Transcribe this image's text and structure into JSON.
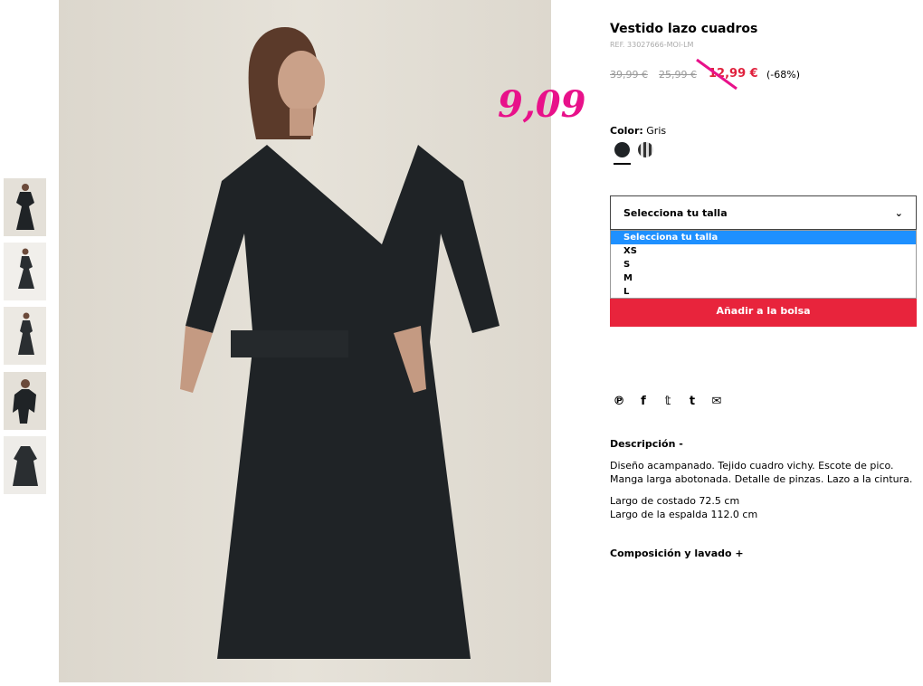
{
  "product": {
    "title": "Vestido lazo cuadros",
    "ref": "REF. 33027666-MOI-LM",
    "prices": {
      "old1": "39,99 €",
      "old2": "25,99 €",
      "current": "12,99 €",
      "discount": "(-68%)"
    },
    "handwritten_price": "9,09",
    "color_label": "Color:",
    "color_value": "Gris",
    "swatches": [
      "dark-solid",
      "gray-check"
    ]
  },
  "size": {
    "selected": "Selecciona tu talla",
    "options": [
      "Selecciona tu talla",
      "XS",
      "S",
      "M",
      "L"
    ]
  },
  "add_to_bag": "Añadir a la bolsa",
  "share": [
    "pinterest",
    "facebook",
    "twitter",
    "tumblr",
    "email"
  ],
  "description": {
    "heading": "Descripción -",
    "p1": "Diseño acampanado. Tejido cuadro vichy. Escote de pico. Manga larga abotonada. Detalle de pinzas. Lazo a la cintura.",
    "p2a": "Largo de costado 72.5 cm",
    "p2b": "Largo de la espalda 112.0 cm"
  },
  "composition": "Composición y lavado +",
  "colors": {
    "accent": "#e8243c",
    "handwritten": "#e8118a",
    "dress": "#1f2326"
  }
}
